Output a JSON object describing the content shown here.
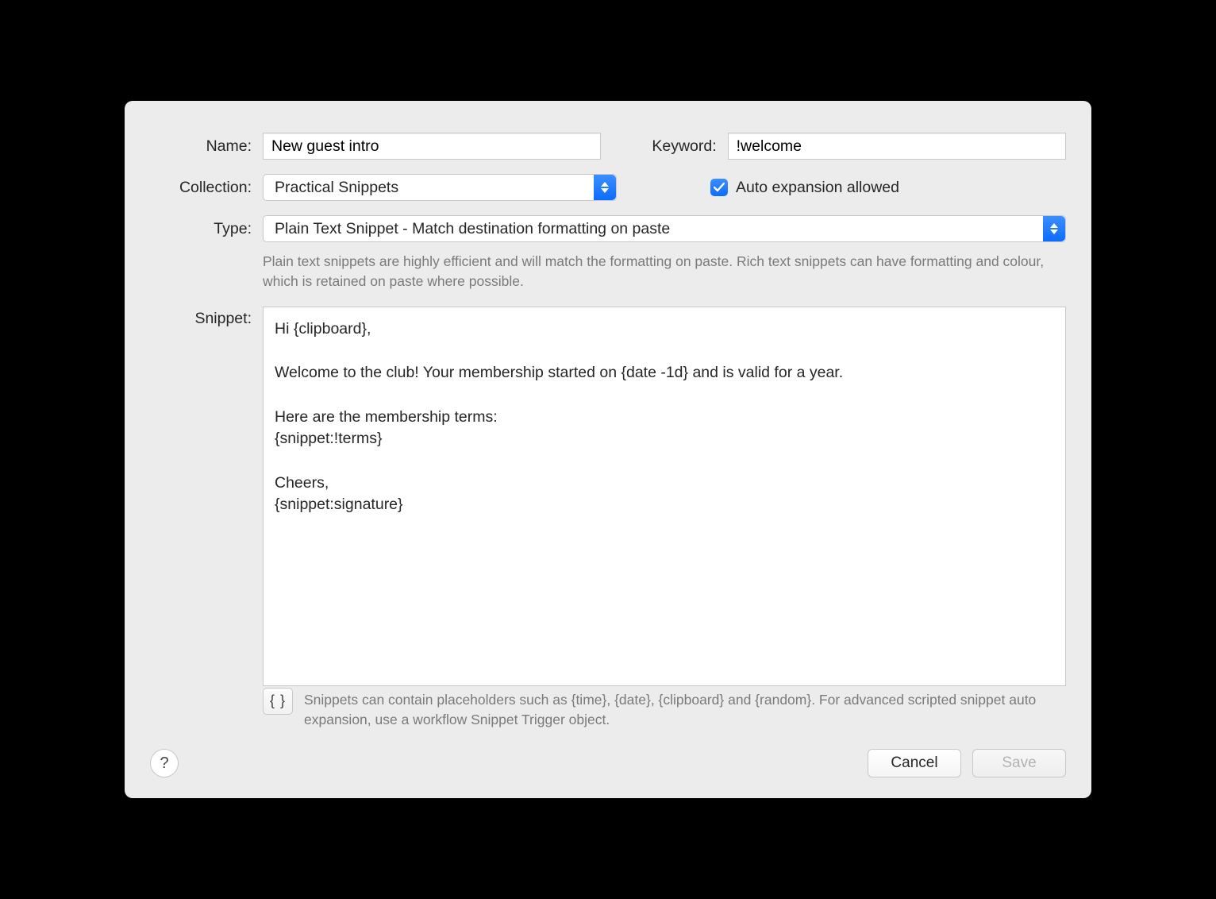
{
  "labels": {
    "name": "Name:",
    "keyword": "Keyword:",
    "collection": "Collection:",
    "type": "Type:",
    "snippet": "Snippet:",
    "auto_expansion": "Auto expansion allowed"
  },
  "fields": {
    "name_value": "New guest intro",
    "keyword_value": "!welcome",
    "collection_value": "Practical Snippets",
    "type_value": "Plain Text Snippet - Match destination formatting on paste",
    "snippet_value": "Hi {clipboard},\n\nWelcome to the club! Your membership started on {date -1d} and is valid for a year.\n\nHere are the membership terms:\n{snippet:!terms}\n\nCheers,\n{snippet:signature}"
  },
  "hints": {
    "type_hint": "Plain text snippets are highly efficient and will match the formatting on paste. Rich text snippets can have formatting and colour, which is retained on paste where possible.",
    "footer_hint": "Snippets can contain placeholders such as {time}, {date}, {clipboard} and {random}. For advanced scripted snippet auto expansion, use a workflow Snippet Trigger object."
  },
  "buttons": {
    "cancel": "Cancel",
    "save": "Save",
    "help": "?",
    "braces": "{ }"
  },
  "state": {
    "auto_expansion_checked": true,
    "save_enabled": false
  }
}
